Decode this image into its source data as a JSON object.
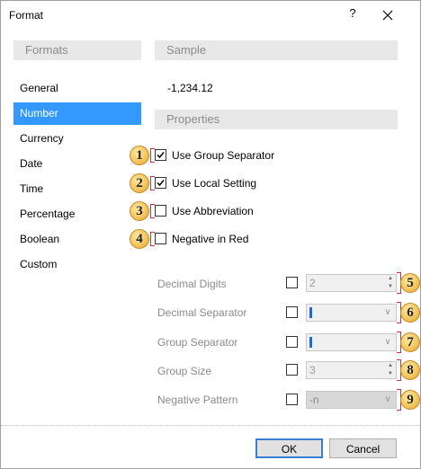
{
  "window": {
    "title": "Format",
    "help_label": "?",
    "close_icon": "close-icon"
  },
  "formats": {
    "header": "Formats",
    "items": [
      {
        "label": "General",
        "selected": false
      },
      {
        "label": "Number",
        "selected": true
      },
      {
        "label": "Currency",
        "selected": false
      },
      {
        "label": "Date",
        "selected": false
      },
      {
        "label": "Time",
        "selected": false
      },
      {
        "label": "Percentage",
        "selected": false
      },
      {
        "label": "Boolean",
        "selected": false
      },
      {
        "label": "Custom",
        "selected": false
      }
    ]
  },
  "sample": {
    "header": "Sample",
    "value": "-1,234.12"
  },
  "properties": {
    "header": "Properties",
    "checkboxes": [
      {
        "marker": "1",
        "label": "Use Group Separator",
        "checked": true
      },
      {
        "marker": "2",
        "label": "Use Local Setting",
        "checked": true
      },
      {
        "marker": "3",
        "label": "Use Abbreviation",
        "checked": false
      },
      {
        "marker": "4",
        "label": "Negative in Red",
        "checked": false
      }
    ],
    "fields": [
      {
        "marker": "5",
        "label": "Decimal Digits",
        "value": "2",
        "kind": "spin",
        "checked": false
      },
      {
        "marker": "6",
        "label": "Decimal Separator",
        "value": "",
        "kind": "combo",
        "checked": false
      },
      {
        "marker": "7",
        "label": "Group Separator",
        "value": "",
        "kind": "combo",
        "checked": false
      },
      {
        "marker": "8",
        "label": "Group Size",
        "value": "3",
        "kind": "spin",
        "checked": false
      },
      {
        "marker": "9",
        "label": "Negative Pattern",
        "value": "-n",
        "kind": "combo-disabled",
        "checked": false
      }
    ]
  },
  "buttons": {
    "ok": "OK",
    "cancel": "Cancel"
  },
  "colors": {
    "selection": "#3399ff",
    "header_bg": "#e8e8e8",
    "marker": "#f2c35a",
    "bracket": "#d03030"
  }
}
